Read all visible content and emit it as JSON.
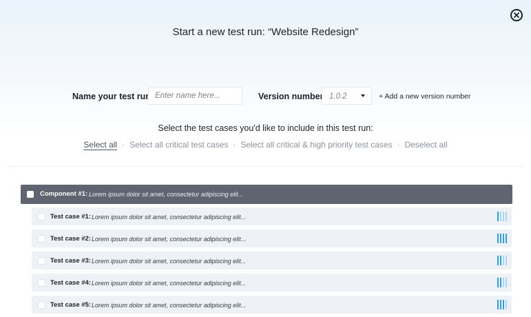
{
  "header": {
    "title": "Start a new test run: “Website Redesign”",
    "close_icon": "close-circle-icon"
  },
  "form": {
    "name_label": "Name your test run:",
    "name_placeholder": "Enter name here...",
    "name_value": "",
    "version_label": "Version number:",
    "version_value": "1.0.2",
    "add_version": "+ Add a new version number"
  },
  "selection": {
    "prompt": "Select the test cases you'd like to include in this test run:",
    "links": [
      {
        "label": "Select all",
        "active": true
      },
      {
        "label": "Select all critical test cases",
        "active": false
      },
      {
        "label": "Select all critical & high priority test cases",
        "active": false
      },
      {
        "label": "Deselect all",
        "active": false
      }
    ]
  },
  "component": {
    "title": "Component #1:",
    "description": "Lorem ipsum dolor sit amet, consectetur adipiscing elit...",
    "checked": false
  },
  "test_cases": [
    {
      "title": "Test case #1:",
      "description": "Lorem ipsum dolor sit amet, consectetur adipiscing elit...",
      "priority_level": 1,
      "checked": false
    },
    {
      "title": "Test case #2:",
      "description": "Lorem ipsum dolor sit amet, consectetur adipiscing elit...",
      "priority_level": 4,
      "checked": false
    },
    {
      "title": "Test case #3:",
      "description": "Lorem ipsum dolor sit amet, consectetur adipiscing elit...",
      "priority_level": 2,
      "checked": false
    },
    {
      "title": "Test case #4:",
      "description": "Lorem ipsum dolor sit amet, consectetur adipiscing elit...",
      "priority_level": 2,
      "checked": false
    },
    {
      "title": "Test case #5:",
      "description": "Lorem ipsum dolor sit amet, consectetur adipiscing elit...",
      "priority_level": 3,
      "checked": false
    }
  ],
  "colors": {
    "priority_active": "#2f9fe0",
    "priority_inactive": "#a8d6f3",
    "component_bg": "#5f6470",
    "case_bg": "#eef2f6"
  }
}
